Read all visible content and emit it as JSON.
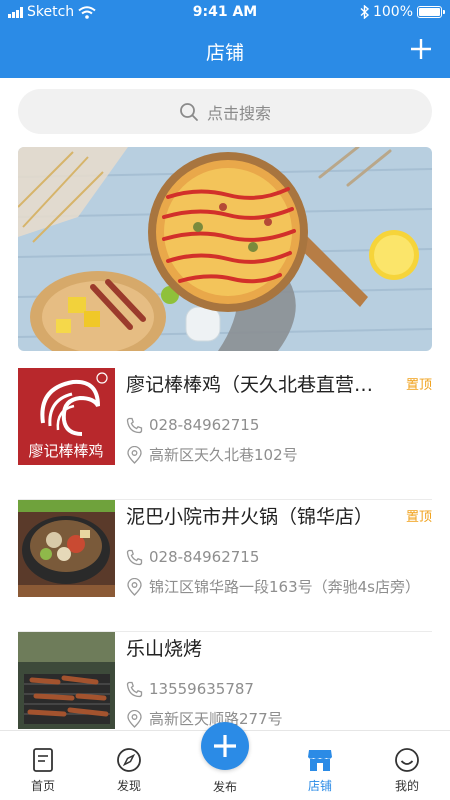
{
  "status_bar": {
    "carrier": "Sketch",
    "time": "9:41 AM",
    "battery": "100%"
  },
  "header": {
    "title": "店铺"
  },
  "search": {
    "placeholder": "点击搜索"
  },
  "stores": [
    {
      "name": "廖记棒棒鸡（天久北巷直营店）",
      "tag": "置顶",
      "phone": "028-84962715",
      "address": "高新区天久北巷102号",
      "logo_text": "廖记棒棒鸡"
    },
    {
      "name": "泥巴小院市井火锅（锦华店）",
      "tag": "置顶",
      "phone": "028-84962715",
      "address": "锦江区锦华路一段163号（奔驰4s店旁）"
    },
    {
      "name": "乐山烧烤",
      "tag": "",
      "phone": "13559635787",
      "address": "高新区天顺路277号"
    }
  ],
  "tabbar": {
    "items": [
      {
        "label": "首页",
        "icon": "document-icon"
      },
      {
        "label": "发现",
        "icon": "compass-icon"
      },
      {
        "label": "发布",
        "icon": "plus-icon"
      },
      {
        "label": "店铺",
        "icon": "store-icon",
        "active": true
      },
      {
        "label": "我的",
        "icon": "smiley-icon"
      }
    ]
  },
  "colors": {
    "primary": "#2b8be6",
    "tag": "#f0a11b",
    "text_secondary": "#8e8e8e"
  }
}
